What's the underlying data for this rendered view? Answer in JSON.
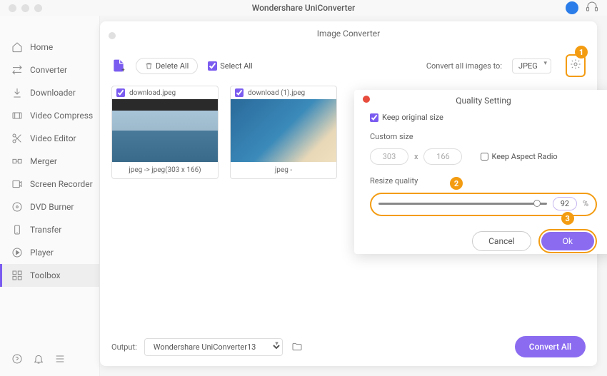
{
  "titlebar": {
    "title": "Wondershare UniConverter"
  },
  "sidebar": {
    "items": [
      {
        "id": "home",
        "label": "Home"
      },
      {
        "id": "converter",
        "label": "Converter"
      },
      {
        "id": "downloader",
        "label": "Downloader"
      },
      {
        "id": "video-compress",
        "label": "Video Compress"
      },
      {
        "id": "video-editor",
        "label": "Video Editor"
      },
      {
        "id": "merger",
        "label": "Merger"
      },
      {
        "id": "screen-recorder",
        "label": "Screen Recorder"
      },
      {
        "id": "dvd-burner",
        "label": "DVD Burner"
      },
      {
        "id": "transfer",
        "label": "Transfer"
      },
      {
        "id": "player",
        "label": "Player"
      },
      {
        "id": "toolbox",
        "label": "Toolbox"
      }
    ],
    "active": "toolbox"
  },
  "panel": {
    "title": "Image Converter"
  },
  "toolbar": {
    "delete_all_label": "Delete All",
    "select_all_label": "Select All",
    "select_all_checked": true,
    "convert_label": "Convert all images to:",
    "format": "JPEG"
  },
  "thumbnails": [
    {
      "filename": "download.jpeg",
      "checked": true,
      "caption": "jpeg -> jpeg(303 x 166)",
      "style": "ocean"
    },
    {
      "filename": "download (1).jpeg",
      "checked": true,
      "caption": "jpeg -",
      "style": "beach"
    }
  ],
  "footer": {
    "output_label": "Output:",
    "output_path": "Wondershare UniConverter13",
    "convert_all_label": "Convert All"
  },
  "modal": {
    "title": "Quality Setting",
    "keep_original_label": "Keep original size",
    "keep_original_checked": true,
    "custom_size_label": "Custom size",
    "width": "303",
    "height": "166",
    "keep_aspect_label": "Keep Aspect Radio",
    "keep_aspect_checked": false,
    "resize_quality_label": "Resize quality",
    "quality_value": "92",
    "quality_pct": "%",
    "cancel_label": "Cancel",
    "ok_label": "Ok"
  },
  "callouts": {
    "one": "1",
    "two": "2",
    "three": "3"
  }
}
